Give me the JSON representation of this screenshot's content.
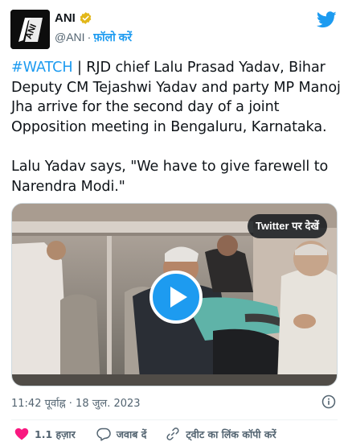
{
  "author": {
    "name": "ANI",
    "handle": "@ANI",
    "separator": "·",
    "follow_label": "फ़ॉलो करें",
    "avatar_text": "ANI"
  },
  "tweet": {
    "hashtag": "#WATCH",
    "body_line": " | RJD chief Lalu Prasad Yadav, Bihar Deputy CM Tejashwi Yadav and party MP Manoj Jha arrive for the second day of a joint Opposition meeting in Bengaluru, Karnataka.",
    "quote": "Lalu Yadav says, \"We have to give farewell to Narendra Modi.\""
  },
  "media": {
    "watch_label": "Twitter पर देखें"
  },
  "timestamp": "11:42 पूर्वाह्न · 18 जुल. 2023",
  "actions": {
    "like_count": "1.1 हज़ार",
    "reply_label": "जवाब दें",
    "copy_link_label": "ट्वीट का लिंक कॉपी करें"
  },
  "colors": {
    "accent": "#1d9bf0",
    "like": "#f91880",
    "text": "#0f1419",
    "muted": "#536471"
  },
  "icons": [
    "verified-badge-icon",
    "twitter-bird-icon",
    "play-icon",
    "info-icon",
    "heart-icon",
    "reply-icon",
    "link-icon"
  ]
}
